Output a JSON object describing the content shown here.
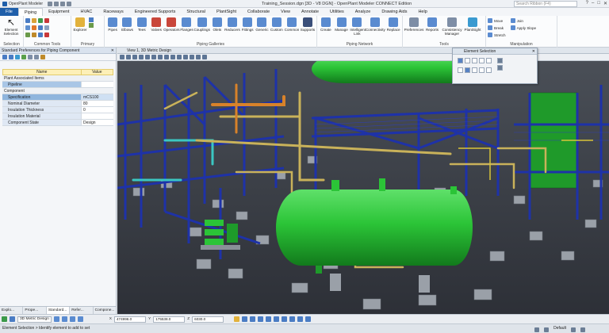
{
  "window": {
    "app_name": "OpenPlant Modeler",
    "title": "Training_Session.dgn [3D - V8 DGN] - OpenPlant Modeler CONNECT Edition",
    "search_placeholder": "Search Ribbon (F4)"
  },
  "menu": {
    "tabs": [
      "File",
      "Piping",
      "Equipment",
      "HVAC",
      "Raceways",
      "Engineered Supports",
      "Structural",
      "PlantSight",
      "Collaborate",
      "View",
      "Annotate",
      "Utilities",
      "Analyze",
      "Drawing Aids",
      "Help"
    ],
    "active": "Piping"
  },
  "ribbon": {
    "groups": [
      {
        "label": "Selection",
        "buttons": [
          "Element Selection"
        ]
      },
      {
        "label": "Common Tools",
        "buttons": []
      },
      {
        "label": "Primary",
        "buttons": [
          "Explorer"
        ]
      },
      {
        "label": "Piping Galleries",
        "buttons": [
          "Pipes",
          "Elbows",
          "Tees",
          "Valves",
          "Operators",
          "Flanges",
          "Couplings",
          "Olets",
          "Reducers",
          "Fittings",
          "Generic",
          "Custom",
          "Common",
          "Supports"
        ]
      },
      {
        "label": "Piping Network",
        "buttons": [
          "Create",
          "Manage",
          "Intelligent Link",
          "Connectivity",
          "Replace"
        ]
      },
      {
        "label": "Tools",
        "buttons": [
          "Preferences",
          "Reports",
          "Consistency Manager",
          "PlantSight"
        ]
      },
      {
        "label": "Manipulation",
        "buttons": [
          "Move",
          "Break",
          "Stretch",
          "Join",
          "Apply Slope"
        ]
      }
    ]
  },
  "left_panel": {
    "title": "Standard Preferences for Piping Component",
    "columns": [
      "Name",
      "Value"
    ],
    "rows": [
      {
        "section": true,
        "name": "Plant Associated Items",
        "value": ""
      },
      {
        "name": "Pipeline",
        "value": ""
      },
      {
        "section": true,
        "name": "Component",
        "value": ""
      },
      {
        "name": "Specification",
        "value": "mCS100"
      },
      {
        "name": "Nominal Diameter",
        "value": "80"
      },
      {
        "name": "Insulation Thickness",
        "value": "0"
      },
      {
        "name": "Insulation Material",
        "value": ""
      },
      {
        "name": "Component State",
        "value": "Design"
      }
    ],
    "bottom_tabs": [
      "Explo...",
      "Prope...",
      "Standard...",
      "Refer...",
      "Compone..."
    ]
  },
  "view": {
    "title": "View 1, 3D Metric Design"
  },
  "element_selection": {
    "title": "Element Selection"
  },
  "status_bar": {
    "model": "3D Metric Design",
    "x_label": "X",
    "x_value": "474996.0",
    "y_label": "Y",
    "y_value": "175538.0",
    "z_label": "Z",
    "z_value": "6030.0",
    "message": "Element Selection > Identify element to add to set",
    "level": "Default"
  },
  "colors": {
    "accent": "#1f5faa",
    "vessel_green": "#2bc437",
    "steel_blue": "#1e32a8",
    "pipe_orange": "#d8822a",
    "pipe_yellow": "#c9b25a"
  }
}
